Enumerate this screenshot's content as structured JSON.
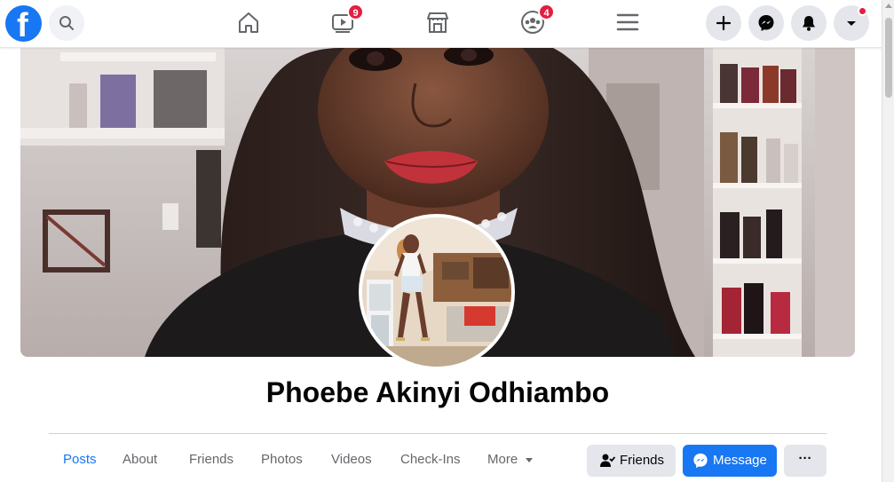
{
  "header": {
    "logo_letter": "f",
    "nav": [
      {
        "name": "home",
        "badge": ""
      },
      {
        "name": "watch",
        "badge": "9"
      },
      {
        "name": "marketplace",
        "badge": ""
      },
      {
        "name": "groups",
        "badge": "4"
      },
      {
        "name": "menu",
        "badge": ""
      }
    ]
  },
  "profile": {
    "name": "Phoebe Akinyi Odhiambo"
  },
  "tabs": [
    {
      "label": "Posts",
      "active": true
    },
    {
      "label": "About"
    },
    {
      "label": "Friends"
    },
    {
      "label": "Photos"
    },
    {
      "label": "Videos"
    },
    {
      "label": "Check-Ins"
    },
    {
      "label": "More"
    }
  ],
  "actions": {
    "friends_label": "Friends",
    "message_label": "Message",
    "more_label": "···"
  },
  "colors": {
    "brand": "#1877f2",
    "badge": "#e41e3f"
  }
}
